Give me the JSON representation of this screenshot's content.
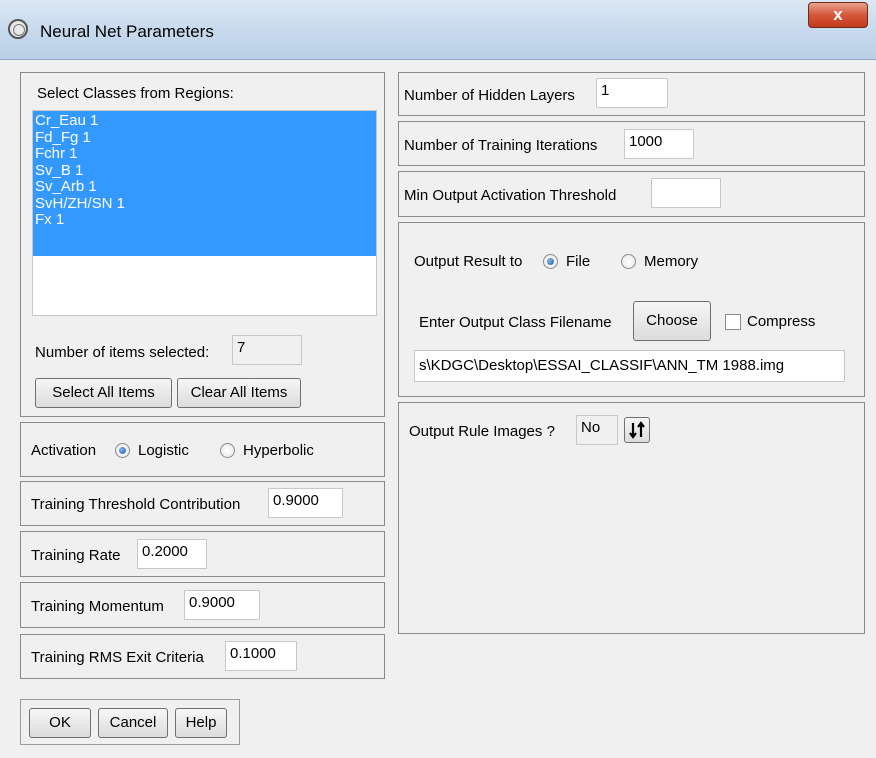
{
  "window": {
    "title": "Neural Net Parameters",
    "close_label": "x"
  },
  "classes": {
    "label": "Select Classes from Regions:",
    "items": [
      "Cr_Eau 1",
      "Fd_Fg 1",
      "Fchr 1",
      "Sv_B 1",
      "Sv_Arb 1",
      "SvH/ZH/SN 1",
      "Fx 1"
    ],
    "selected_count_label": "Number of items selected:",
    "selected_count": "7",
    "select_all_label": "Select All Items",
    "clear_all_label": "Clear All Items"
  },
  "activation": {
    "label": "Activation",
    "options": [
      "Logistic",
      "Hyperbolic"
    ],
    "selected": "Logistic"
  },
  "training": {
    "threshold_label": "Training Threshold Contribution",
    "threshold_value": "0.9000",
    "rate_label": "Training Rate",
    "rate_value": "0.2000",
    "momentum_label": "Training Momentum",
    "momentum_value": "0.9000",
    "rms_label": "Training RMS Exit Criteria",
    "rms_value": "0.1000"
  },
  "network": {
    "hidden_layers_label": "Number of Hidden Layers",
    "hidden_layers_value": "1",
    "iterations_label": "Number of Training Iterations",
    "iterations_value": "1000",
    "min_activation_label": "Min Output Activation Threshold",
    "min_activation_value": ""
  },
  "output": {
    "result_to_label": "Output Result to",
    "options": [
      "File",
      "Memory"
    ],
    "selected": "File",
    "filename_label": "Enter Output Class Filename",
    "choose_label": "Choose",
    "compress_label": "Compress",
    "compress_checked": false,
    "filename_value": "s\\KDGC\\Desktop\\ESSAI_CLASSIF\\ANN_TM 1988.img",
    "rule_images_label": "Output Rule Images ?",
    "rule_images_value": "No",
    "toggle_icon": "up-down-arrows-icon"
  },
  "buttons": {
    "ok": "OK",
    "cancel": "Cancel",
    "help": "Help"
  }
}
